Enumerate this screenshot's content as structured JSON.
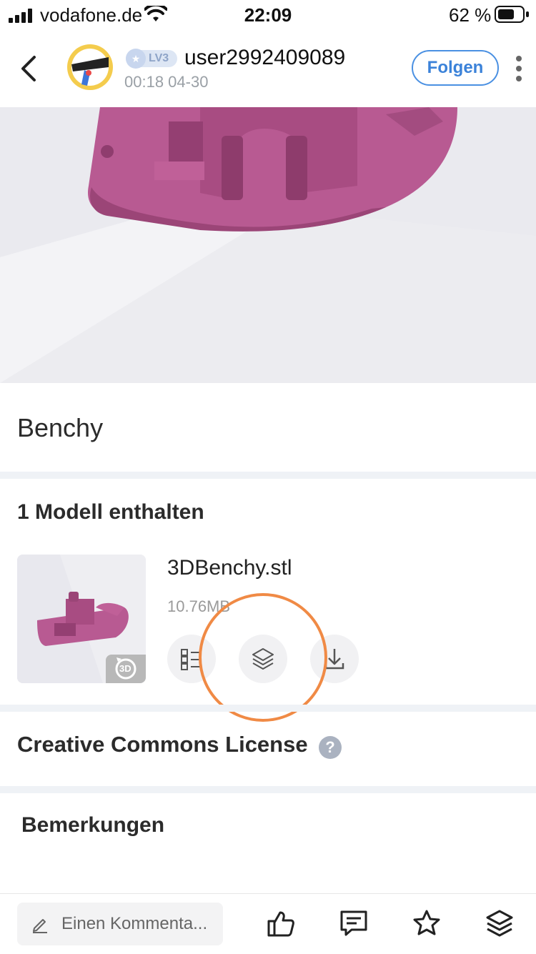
{
  "status_bar": {
    "carrier": "vodafone.de",
    "time": "22:09",
    "battery_percent": "62 %"
  },
  "header": {
    "username": "user2992409089",
    "level_badge": "LV3",
    "timestamp": "00:18 04-30",
    "follow_label": "Folgen"
  },
  "post": {
    "title": "Benchy"
  },
  "models": {
    "heading": "1  Modell enthalten",
    "items": [
      {
        "file_name": "3DBenchy.stl",
        "file_size": "10.76MB",
        "badge": "3D"
      }
    ]
  },
  "license": {
    "label": "Creative Commons License",
    "help_icon_text": "?"
  },
  "remarks": {
    "heading": "Bemerkungen"
  },
  "bottom_bar": {
    "comment_placeholder": "Einen Kommenta..."
  },
  "colors": {
    "accent_blue": "#4a90e2",
    "model_pink": "#b5558f",
    "highlight_orange": "#f08a45",
    "divider": "#eff2f6"
  },
  "icons": [
    "back-icon",
    "more-icon",
    "list-icon",
    "layers-icon",
    "download-icon",
    "pencil-icon",
    "like-icon",
    "comment-icon",
    "star-icon",
    "layers-icon",
    "rotate-3d-icon",
    "help-icon"
  ]
}
